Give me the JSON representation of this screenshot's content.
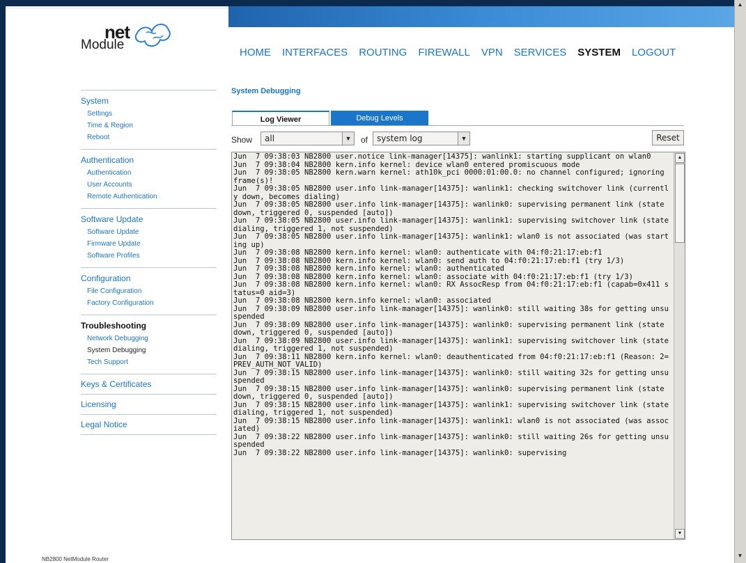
{
  "logo": {
    "word1": "net",
    "word2": "Module",
    "icon": "puzzle-logo-icon"
  },
  "topnav": [
    "HOME",
    "INTERFACES",
    "ROUTING",
    "FIREWALL",
    "VPN",
    "SERVICES",
    "SYSTEM",
    "LOGOUT"
  ],
  "topnav_active": "SYSTEM",
  "sidebar": {
    "groups": [
      {
        "title": "System",
        "items": [
          "Settings",
          "Time & Region",
          "Reboot"
        ]
      },
      {
        "title": "Authentication",
        "items": [
          "Authentication",
          "User Accounts",
          "Remote Authentication"
        ]
      },
      {
        "title": "Software Update",
        "items": [
          "Software Update",
          "Firmware Update",
          "Software Profiles"
        ]
      },
      {
        "title": "Configuration",
        "items": [
          "File Configuration",
          "Factory Configuration"
        ]
      },
      {
        "title": "Troubleshooting",
        "items": [
          "Network Debugging",
          "System Debugging",
          "Tech Support"
        ]
      },
      {
        "title": "Keys & Certificates",
        "items": []
      },
      {
        "title": "Licensing",
        "items": []
      },
      {
        "title": "Legal Notice",
        "items": []
      }
    ],
    "active_group": "Troubleshooting",
    "active_item": "System Debugging"
  },
  "main": {
    "title": "System Debugging",
    "tabs": {
      "log_viewer": "Log Viewer",
      "debug_levels": "Debug Levels"
    },
    "filters": {
      "show_label": "Show",
      "show_value": "all",
      "of_label": "of",
      "source_value": "system log",
      "reset_label": "Reset"
    },
    "log_lines": [
      "Jun  7 09:38:03 NB2800 user.notice link-manager[14375]: wanlink1: starting supplicant on wlan0",
      "Jun  7 09:38:04 NB2800 kern.info kernel: device wlan0 entered promiscuous mode",
      "Jun  7 09:38:05 NB2800 kern.warn kernel: ath10k_pci 0000:01:00.0: no channel configured; ignoring frame(s)!",
      "Jun  7 09:38:05 NB2800 user.info link-manager[14375]: wanlink1: checking switchover link (currently down, becomes dialing)",
      "Jun  7 09:38:05 NB2800 user.info link-manager[14375]: wanlink0: supervising permanent link (state down, triggered 0, suspended [auto])",
      "Jun  7 09:38:05 NB2800 user.info link-manager[14375]: wanlink1: supervising switchover link (state dialing, triggered 1, not suspended)",
      "Jun  7 09:38:05 NB2800 user.info link-manager[14375]: wanlink1: wlan0 is not associated (was starting up)",
      "Jun  7 09:38:08 NB2800 kern.info kernel: wlan0: authenticate with 04:f0:21:17:eb:f1",
      "Jun  7 09:38:08 NB2800 kern.info kernel: wlan0: send auth to 04:f0:21:17:eb:f1 (try 1/3)",
      "Jun  7 09:38:08 NB2800 kern.info kernel: wlan0: authenticated",
      "Jun  7 09:38:08 NB2800 kern.info kernel: wlan0: associate with 04:f0:21:17:eb:f1 (try 1/3)",
      "Jun  7 09:38:08 NB2800 kern.info kernel: wlan0: RX AssocResp from 04:f0:21:17:eb:f1 (capab=0x411 status=0 aid=3)",
      "Jun  7 09:38:08 NB2800 kern.info kernel: wlan0: associated",
      "Jun  7 09:38:09 NB2800 user.info link-manager[14375]: wanlink0: still waiting 38s for getting unsuspended",
      "Jun  7 09:38:09 NB2800 user.info link-manager[14375]: wanlink0: supervising permanent link (state down, triggered 0, suspended [auto])",
      "Jun  7 09:38:09 NB2800 user.info link-manager[14375]: wanlink1: supervising switchover link (state dialing, triggered 1, not suspended)",
      "Jun  7 09:38:11 NB2800 kern.info kernel: wlan0: deauthenticated from 04:f0:21:17:eb:f1 (Reason: 2=PREV_AUTH_NOT_VALID)",
      "Jun  7 09:38:15 NB2800 user.info link-manager[14375]: wanlink0: still waiting 32s for getting unsuspended",
      "Jun  7 09:38:15 NB2800 user.info link-manager[14375]: wanlink0: supervising permanent link (state down, triggered 0, suspended [auto])",
      "Jun  7 09:38:15 NB2800 user.info link-manager[14375]: wanlink1: supervising switchover link (state dialing, triggered 1, not suspended)",
      "Jun  7 09:38:15 NB2800 user.info link-manager[14375]: wanlink1: wlan0 is not associated (was associated)",
      "Jun  7 09:38:22 NB2800 user.info link-manager[14375]: wanlink0: still waiting 26s for getting unsuspended",
      "Jun  7 09:38:22 NB2800 user.info link-manager[14375]: wanlink0: supervising"
    ]
  },
  "footer": "NB2800 NetModule Router",
  "colors": {
    "accent": "#1b75c9",
    "background": "#0c2a4d",
    "log_bg": "#efede8"
  }
}
